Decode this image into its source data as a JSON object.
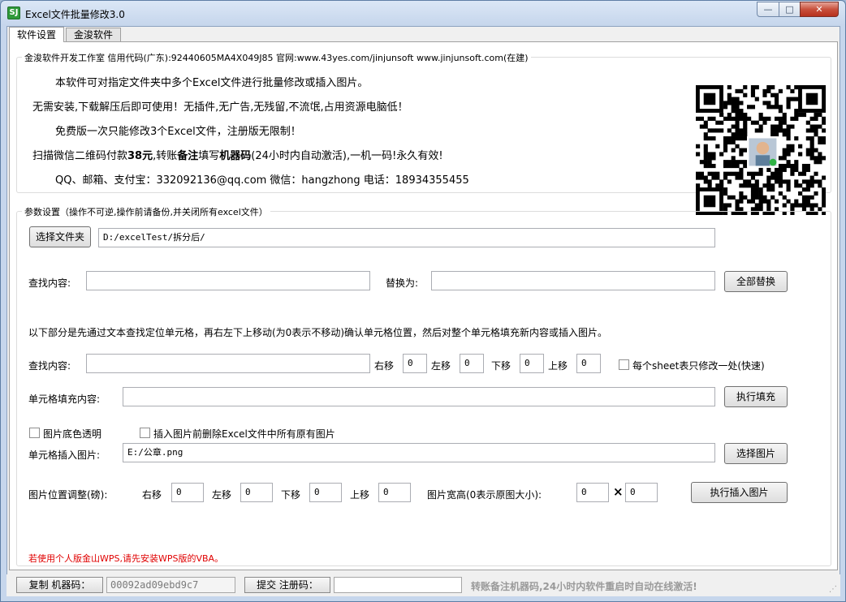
{
  "window": {
    "title": "Excel文件批量修改3.0",
    "icon_text": "SJ"
  },
  "tabs": [
    {
      "label": "软件设置"
    },
    {
      "label": "金浚软件"
    }
  ],
  "info": {
    "group_title": "金浚软件开发工作室 信用代码(广东):92440605MA4X049J85 官网:www.43yes.com/jinjunsoft  www.jinjunsoft.com(在建)",
    "line1": "本软件可对指定文件夹中多个Excel文件进行批量修改或插入图片。",
    "line2": "无需安装,下载解压后即可使用！无插件,无广告,无残留,不流氓,占用资源电脑低！",
    "line3": "免费版一次只能修改3个Excel文件，注册版无限制！",
    "line4_a": "扫描微信二维码付款",
    "line4_price": "38元",
    "line4_b": ",转账",
    "line4_note": "备注",
    "line4_c": "填写",
    "line4_code": "机器码",
    "line4_d": "(24小时内自动激活),一机一码!永久有效!",
    "line5": "QQ、邮箱、支付宝：332092136@qq.com    微信：hangzhong    电话：18934355455"
  },
  "params": {
    "group_title": "参数设置（操作不可逆,操作前请备份,并关闭所有excel文件）",
    "choose_folder_label": "选择文件夹",
    "folder_path": "D:/excelTest/拆分后/",
    "find_label": "查找内容:",
    "find_value": "",
    "replace_label": "替换为:",
    "replace_value": "",
    "replace_all_label": "全部替换",
    "desc": "以下部分是先通过文本查找定位单元格，再右左下上移动(为0表示不移动)确认单元格位置，然后对整个单元格填充新内容或插入图片。",
    "find2_label": "查找内容:",
    "find2_value": "",
    "right_label": "右移",
    "right_value": "0",
    "left_label": "左移",
    "left_value": "0",
    "down_label": "下移",
    "down_value": "0",
    "up_label": "上移",
    "up_value": "0",
    "once_per_sheet_label": "每个sheet表只修改一处(快速)",
    "fill_label": "单元格填充内容:",
    "fill_value": "",
    "fill_btn": "执行填充",
    "transparent_label": "图片底色透明",
    "delete_images_label": "插入图片前删除Excel文件中所有原有图片",
    "insert_img_label": "单元格插入图片:",
    "img_path": "E:/公章.png",
    "choose_img_btn": "选择图片",
    "pos_adjust_label": "图片位置调整(磅):",
    "p_right_label": "右移",
    "p_right_value": "0",
    "p_left_label": "左移",
    "p_left_value": "0",
    "p_down_label": "下移",
    "p_down_value": "0",
    "p_up_label": "上移",
    "p_up_value": "0",
    "size_label": "图片宽高(0表示原图大小):",
    "width_value": "0",
    "times_sign": "×",
    "height_value": "0",
    "insert_btn": "执行插入图片",
    "wps_note": "若使用个人版金山WPS,请先安装WPS版的VBA。"
  },
  "status": {
    "copy_btn": "复制 机器码：",
    "machine_code": "00092ad09ebd9c7",
    "submit_btn": "提交 注册码：",
    "reg_code": "",
    "note": "转账备注机器码,24小时内软件重启时自动在线激活!"
  },
  "colors": {
    "warning": "#e00000",
    "titlebar": "#c6d6ec"
  }
}
